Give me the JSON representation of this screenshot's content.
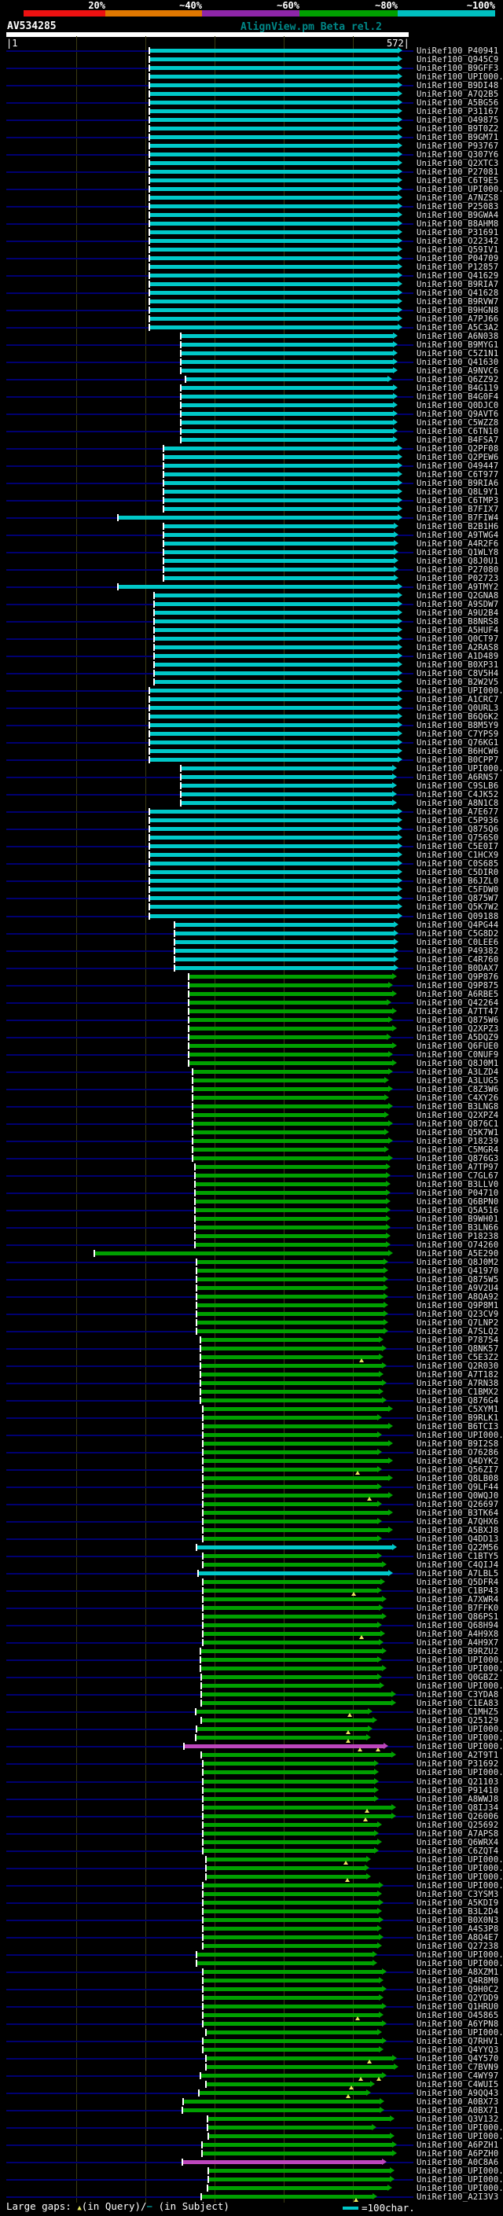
{
  "header": {
    "identity_key": {
      "labels": [
        "20%",
        "~40%",
        "~60%",
        "~80%",
        "~100%"
      ],
      "colors": [
        "#ee1111",
        "#e07800",
        "#8e26a8",
        "#00a000",
        "#00c0c0"
      ],
      "segment_bounds": [
        30,
        134,
        257,
        381,
        506,
        630
      ]
    },
    "query_name": "AV534285",
    "app_title": "AlignView.pm Beta rel.2",
    "ruler": {
      "start_label": "|1",
      "end_label": "572|",
      "start": 1,
      "end": 572,
      "ticks": [
        100,
        200,
        300,
        400,
        500
      ]
    }
  },
  "legend_footer": {
    "large_gaps_prefix": "Large gaps: ",
    "query_gap_symbol": "▲",
    "in_query": "(in Query)/",
    "subject_gap_symbol": "−",
    "in_subject": " (in Subject)",
    "scale_text": "=100char."
  },
  "colors": {
    "c": "#00c8c8",
    "g": "#00a000",
    "m": "#bc46bc",
    "leader": "#000070",
    "gap_marker": "#e8e860",
    "scale_swatch": "#00c8c8"
  },
  "label_prefix": "UniRef100_",
  "rows": [
    [
      "P40941",
      "c",
      190,
      512
    ],
    [
      "Q945C9",
      "c",
      190,
      512
    ],
    [
      "B9GFF3",
      "c",
      190,
      512
    ],
    [
      "UPI000..",
      "c",
      190,
      512
    ],
    [
      "B9DI48",
      "c",
      190,
      512
    ],
    [
      "A7Q2B5",
      "c",
      190,
      512
    ],
    [
      "A5BG56",
      "c",
      190,
      512
    ],
    [
      "P31167",
      "c",
      190,
      512
    ],
    [
      "O49875",
      "c",
      190,
      512
    ],
    [
      "B9T0Z2",
      "c",
      190,
      512
    ],
    [
      "B9GM71",
      "c",
      190,
      512
    ],
    [
      "P93767",
      "c",
      190,
      512
    ],
    [
      "Q307Y6",
      "c",
      190,
      512
    ],
    [
      "Q2XTC3",
      "c",
      190,
      512
    ],
    [
      "P27081",
      "c",
      190,
      512
    ],
    [
      "C6T9E5",
      "c",
      190,
      512
    ],
    [
      "UPI000..",
      "c",
      190,
      512
    ],
    [
      "A7NZS8",
      "c",
      190,
      512
    ],
    [
      "P25083",
      "c",
      190,
      512
    ],
    [
      "B9GWA4",
      "c",
      190,
      512
    ],
    [
      "B8AHM8",
      "c",
      190,
      512
    ],
    [
      "P31691",
      "c",
      190,
      512
    ],
    [
      "O22342",
      "c",
      190,
      512
    ],
    [
      "Q59IV1",
      "c",
      190,
      512
    ],
    [
      "P04709",
      "c",
      190,
      512
    ],
    [
      "P12857",
      "c",
      190,
      512
    ],
    [
      "Q41629",
      "c",
      190,
      512
    ],
    [
      "B9RIA7",
      "c",
      190,
      512
    ],
    [
      "Q41628",
      "c",
      190,
      512
    ],
    [
      "B9RVW7",
      "c",
      190,
      512
    ],
    [
      "B9HGN8",
      "c",
      190,
      512
    ],
    [
      "A7PJ66",
      "c",
      190,
      512
    ],
    [
      "A5C3A2",
      "c",
      190,
      512
    ],
    [
      "A6N038",
      "c",
      230,
      506
    ],
    [
      "B9MYG1",
      "c",
      230,
      506
    ],
    [
      "C5Z1N1",
      "c",
      230,
      506
    ],
    [
      "Q41630",
      "c",
      230,
      506
    ],
    [
      "A9NVC6",
      "c",
      230,
      506
    ],
    [
      "Q6ZZ92",
      "c",
      236,
      499
    ],
    [
      "B4G119",
      "c",
      230,
      506
    ],
    [
      "B4G0F4",
      "c",
      230,
      506
    ],
    [
      "Q0DJC0",
      "c",
      230,
      506
    ],
    [
      "Q9AVT6",
      "c",
      230,
      506
    ],
    [
      "C5WZZ8",
      "c",
      230,
      506
    ],
    [
      "C6TN10",
      "c",
      230,
      506
    ],
    [
      "B4FSA7",
      "c",
      230,
      506
    ],
    [
      "Q2PF08",
      "c",
      208,
      512
    ],
    [
      "Q2PEW6",
      "c",
      208,
      512
    ],
    [
      "O49447",
      "c",
      208,
      512
    ],
    [
      "C6T977",
      "c",
      208,
      512
    ],
    [
      "B9RIA6",
      "c",
      208,
      512
    ],
    [
      "Q8L9Y1",
      "c",
      208,
      512
    ],
    [
      "C6TMP3",
      "c",
      208,
      512
    ],
    [
      "B7FIX7",
      "c",
      208,
      512
    ],
    [
      "B7FIW4",
      "c",
      150,
      512
    ],
    [
      "B2B1H6",
      "c",
      208,
      507
    ],
    [
      "A9TWG4",
      "c",
      208,
      507
    ],
    [
      "A4R2F6",
      "c",
      208,
      507
    ],
    [
      "Q1WLY8",
      "c",
      208,
      507
    ],
    [
      "Q8J0U1",
      "c",
      208,
      507
    ],
    [
      "P27080",
      "c",
      208,
      507
    ],
    [
      "P02723",
      "c",
      208,
      507
    ],
    [
      "A9TMY2",
      "c",
      150,
      512
    ],
    [
      "Q2GNA8",
      "c",
      196,
      512
    ],
    [
      "A9SDW7",
      "c",
      196,
      512
    ],
    [
      "A9U2B4",
      "c",
      196,
      512
    ],
    [
      "B8NRS8",
      "c",
      196,
      512
    ],
    [
      "A5HUF4",
      "c",
      196,
      512
    ],
    [
      "Q0CT97",
      "c",
      196,
      512
    ],
    [
      "A2RAS8",
      "c",
      196,
      512
    ],
    [
      "A1D489",
      "c",
      196,
      512
    ],
    [
      "B0XP31",
      "c",
      196,
      512
    ],
    [
      "C8V5H4",
      "c",
      196,
      512
    ],
    [
      "B2W2V5",
      "c",
      196,
      512
    ],
    [
      "UPI000..",
      "c",
      190,
      512
    ],
    [
      "A1CRC7",
      "c",
      190,
      512
    ],
    [
      "Q0URL3",
      "c",
      190,
      512
    ],
    [
      "B6Q6K2",
      "c",
      190,
      512
    ],
    [
      "B8M5Y9",
      "c",
      190,
      512
    ],
    [
      "C7YPS9",
      "c",
      190,
      512
    ],
    [
      "Q76KG1",
      "c",
      190,
      512
    ],
    [
      "B6HCW6",
      "c",
      190,
      512
    ],
    [
      "B0CPP7",
      "c",
      190,
      512
    ],
    [
      "UPI000..",
      "c",
      230,
      505
    ],
    [
      "A6RNS7",
      "c",
      230,
      505
    ],
    [
      "C9SLB6",
      "c",
      230,
      505
    ],
    [
      "C4JK52",
      "c",
      230,
      505
    ],
    [
      "A8N1C8",
      "c",
      230,
      505
    ],
    [
      "A7E677",
      "c",
      190,
      512
    ],
    [
      "C5P936",
      "c",
      190,
      512
    ],
    [
      "Q875Q6",
      "c",
      190,
      512
    ],
    [
      "Q756S0",
      "c",
      190,
      512
    ],
    [
      "C5E0I7",
      "c",
      190,
      512
    ],
    [
      "C1HCX9",
      "c",
      190,
      512
    ],
    [
      "C0S685",
      "c",
      190,
      512
    ],
    [
      "C5DIR0",
      "c",
      190,
      512
    ],
    [
      "B6JZL0",
      "c",
      190,
      512
    ],
    [
      "C5FDW0",
      "c",
      190,
      512
    ],
    [
      "Q875W7",
      "c",
      190,
      512
    ],
    [
      "Q5K7W2",
      "c",
      190,
      512
    ],
    [
      "Q09188",
      "c",
      190,
      512
    ],
    [
      "Q4PG44",
      "c",
      222,
      507
    ],
    [
      "C5G8D2",
      "c",
      222,
      507
    ],
    [
      "C0LEE6",
      "c",
      222,
      507
    ],
    [
      "P49382",
      "c",
      222,
      507
    ],
    [
      "C4R760",
      "c",
      222,
      507
    ],
    [
      "B0DAX7",
      "c",
      222,
      507
    ],
    [
      "Q9P876",
      "g",
      240,
      505
    ],
    [
      "Q9P875",
      "g",
      240,
      500
    ],
    [
      "A6RBE5",
      "g",
      240,
      505
    ],
    [
      "Q42264",
      "g",
      240,
      498
    ],
    [
      "A7TT47",
      "g",
      240,
      505
    ],
    [
      "Q875W6",
      "g",
      240,
      500
    ],
    [
      "Q2XPZ3",
      "g",
      240,
      505
    ],
    [
      "A5DQZ9",
      "g",
      240,
      498
    ],
    [
      "Q6FUE0",
      "g",
      240,
      505
    ],
    [
      "C0NUF9",
      "g",
      240,
      500
    ],
    [
      "Q8J0M1",
      "g",
      240,
      505
    ],
    [
      "A3LZD4",
      "g",
      245,
      500
    ],
    [
      "A3LUG5",
      "g",
      245,
      495
    ],
    [
      "C8Z3W6",
      "g",
      245,
      500
    ],
    [
      "C4XY26",
      "g",
      245,
      495
    ],
    [
      "B3LNG8",
      "g",
      245,
      500
    ],
    [
      "Q2XPZ4",
      "g",
      245,
      495
    ],
    [
      "Q876C1",
      "g",
      245,
      500
    ],
    [
      "Q5K7W1",
      "g",
      245,
      495
    ],
    [
      "P18239",
      "g",
      245,
      500
    ],
    [
      "C5MGR4",
      "g",
      245,
      495
    ],
    [
      "Q876G3",
      "g",
      245,
      500
    ],
    [
      "A7TP97",
      "g",
      248,
      497
    ],
    [
      "C7GL67",
      "g",
      248,
      497
    ],
    [
      "B3LLV0",
      "g",
      248,
      497
    ],
    [
      "P04710",
      "g",
      248,
      497
    ],
    [
      "Q6BPN0",
      "g",
      248,
      497
    ],
    [
      "Q5A516",
      "g",
      248,
      497
    ],
    [
      "B9WH01",
      "g",
      248,
      497
    ],
    [
      "B3LN66",
      "g",
      248,
      497
    ],
    [
      "P18238",
      "g",
      248,
      497
    ],
    [
      "O74260",
      "g",
      248,
      497
    ],
    [
      "A5E290",
      "g",
      120,
      500
    ],
    [
      "Q8J0M2",
      "g",
      250,
      494
    ],
    [
      "Q41970",
      "g",
      250,
      494
    ],
    [
      "Q875W5",
      "g",
      250,
      494
    ],
    [
      "A9V2U4",
      "g",
      250,
      494
    ],
    [
      "A8QA92",
      "g",
      250,
      494
    ],
    [
      "Q9P8M1",
      "g",
      250,
      494
    ],
    [
      "Q23CV9",
      "g",
      250,
      494
    ],
    [
      "Q7LNP2",
      "g",
      250,
      494
    ],
    [
      "A7SLQ2",
      "g",
      250,
      494
    ],
    [
      "P78754",
      "g",
      255,
      488
    ],
    [
      "Q8NK57",
      "g",
      255,
      492
    ],
    [
      "C5E3Z2",
      "g",
      255,
      488,
      [
        460
      ]
    ],
    [
      "Q2R030",
      "g",
      255,
      492
    ],
    [
      "A7T182",
      "g",
      255,
      488
    ],
    [
      "A7RN38",
      "g",
      255,
      492
    ],
    [
      "C1BMX2",
      "g",
      255,
      488
    ],
    [
      "Q876G4",
      "g",
      255,
      492
    ],
    [
      "C5XYM1",
      "g",
      258,
      500
    ],
    [
      "B9RLK1",
      "g",
      258,
      486
    ],
    [
      "B6TCI3",
      "g",
      258,
      500
    ],
    [
      "UPI000..",
      "g",
      258,
      486
    ],
    [
      "B9I2S8",
      "g",
      258,
      500
    ],
    [
      "O76286",
      "g",
      258,
      486
    ],
    [
      "Q4DYK2",
      "g",
      258,
      500
    ],
    [
      "Q56ZI7",
      "g",
      258,
      486,
      [
        455
      ]
    ],
    [
      "Q8LB08",
      "g",
      258,
      500
    ],
    [
      "Q9LF44",
      "g",
      258,
      486
    ],
    [
      "Q0WQJ0",
      "g",
      258,
      500,
      [
        470
      ]
    ],
    [
      "Q26697",
      "g",
      258,
      486
    ],
    [
      "B3TK64",
      "g",
      258,
      500
    ],
    [
      "A7QHX6",
      "g",
      258,
      486
    ],
    [
      "A5BXJ8",
      "g",
      258,
      500
    ],
    [
      "Q4DD13",
      "g",
      258,
      486
    ],
    [
      "Q22M56",
      "c",
      250,
      505
    ],
    [
      "C1BTY5",
      "g",
      258,
      486
    ],
    [
      "C4QIJ4",
      "g",
      258,
      492
    ],
    [
      "A7LBL5",
      "c",
      252,
      500
    ],
    [
      "Q5DFR4",
      "g",
      258,
      490
    ],
    [
      "C1BP43",
      "g",
      258,
      486,
      [
        450
      ]
    ],
    [
      "A7XWR4",
      "g",
      258,
      492
    ],
    [
      "B7FFK0",
      "g",
      258,
      488
    ],
    [
      "Q86PS1",
      "g",
      258,
      492
    ],
    [
      "Q68H94",
      "g",
      258,
      486
    ],
    [
      "A4H9X8",
      "g",
      258,
      490,
      [
        460
      ]
    ],
    [
      "A4H9X7",
      "g",
      258,
      488
    ],
    [
      "B9RZU2",
      "g",
      255,
      492
    ],
    [
      "UPI000..",
      "g",
      255,
      486
    ],
    [
      "UPI000..",
      "g",
      255,
      492
    ],
    [
      "Q0GBZ2",
      "g",
      256,
      486
    ],
    [
      "UPI000..",
      "g",
      256,
      489
    ],
    [
      "C3YDA8",
      "g",
      256,
      504
    ],
    [
      "C1EA83",
      "g",
      256,
      504
    ],
    [
      "C1MHZ5",
      "g",
      249,
      474,
      [
        445
      ]
    ],
    [
      "Q25129",
      "g",
      256,
      480
    ],
    [
      "UPI000..",
      "g",
      250,
      474,
      [
        443
      ]
    ],
    [
      "UPI000..",
      "g",
      249,
      472,
      [
        443
      ]
    ],
    [
      "UPI000..",
      "m",
      234,
      494,
      [
        458,
        481
      ]
    ],
    [
      "A2T9T1",
      "g",
      256,
      504
    ],
    [
      "P31692",
      "g",
      258,
      482
    ],
    [
      "UPI000..",
      "g",
      258,
      482
    ],
    [
      "Q21103",
      "g",
      258,
      482
    ],
    [
      "P91410",
      "g",
      258,
      482
    ],
    [
      "A8WWJ8",
      "g",
      258,
      482
    ],
    [
      "Q8IJ34",
      "g",
      258,
      504,
      [
        467
      ]
    ],
    [
      "Q26006",
      "g",
      258,
      504,
      [
        465
      ]
    ],
    [
      "Q25692",
      "g",
      258,
      486
    ],
    [
      "A7APS8",
      "g",
      258,
      482
    ],
    [
      "Q6WRX4",
      "g",
      258,
      486
    ],
    [
      "C6ZQT4",
      "g",
      258,
      482
    ],
    [
      "UPI000..",
      "g",
      262,
      472,
      [
        440
      ]
    ],
    [
      "UPI000..",
      "g",
      262,
      470
    ],
    [
      "UPI000..",
      "g",
      262,
      472,
      [
        442
      ]
    ],
    [
      "UPI000..",
      "g",
      258,
      488
    ],
    [
      "C3YSM3",
      "g",
      258,
      486
    ],
    [
      "A5KDI9",
      "g",
      258,
      488
    ],
    [
      "B3L2D4",
      "g",
      258,
      486
    ],
    [
      "B0X0N3",
      "g",
      258,
      488
    ],
    [
      "A4S3P8",
      "g",
      258,
      486
    ],
    [
      "A8Q4E7",
      "g",
      258,
      488
    ],
    [
      "Q27238",
      "g",
      258,
      486
    ],
    [
      "UPI000..",
      "g",
      250,
      480
    ],
    [
      "UPI000..",
      "g",
      250,
      480
    ],
    [
      "A8XZM1",
      "g",
      258,
      492
    ],
    [
      "Q4R8M0",
      "g",
      258,
      488
    ],
    [
      "Q9H0C2",
      "g",
      258,
      492
    ],
    [
      "Q2YDD9",
      "g",
      258,
      488
    ],
    [
      "Q1HRU0",
      "g",
      258,
      492
    ],
    [
      "O45865",
      "g",
      258,
      488,
      [
        455
      ]
    ],
    [
      "A6YPN8",
      "g",
      258,
      492
    ],
    [
      "UPI000..",
      "g",
      262,
      486
    ],
    [
      "Q7RHV1",
      "g",
      258,
      492
    ],
    [
      "Q4YYQ3",
      "g",
      258,
      488
    ],
    [
      "Q4Y570",
      "g",
      262,
      505,
      [
        470
      ]
    ],
    [
      "C7BVN9",
      "g",
      262,
      507
    ],
    [
      "C4WY97",
      "g",
      255,
      492,
      [
        459,
        482
      ]
    ],
    [
      "C4WUI5",
      "g",
      262,
      477,
      [
        447
      ]
    ],
    [
      "A9QQ43",
      "g",
      253,
      472,
      [
        443
      ]
    ],
    [
      "A0BX73",
      "g",
      233,
      489
    ],
    [
      "A0BX71",
      "g",
      232,
      489
    ],
    [
      "Q3V132",
      "g",
      264,
      502
    ],
    [
      "UPI000..",
      "g",
      264,
      479
    ],
    [
      "UPI000..",
      "g",
      265,
      502
    ],
    [
      "A6PZH1",
      "g",
      257,
      505
    ],
    [
      "A6PZH0",
      "g",
      257,
      505
    ],
    [
      "A0C8A6",
      "m",
      232,
      492
    ],
    [
      "UPI000..",
      "g",
      265,
      502
    ],
    [
      "UPI000..",
      "g",
      265,
      502
    ],
    [
      "UPI000..",
      "g",
      264,
      499
    ],
    [
      "A2I3V3",
      "g",
      256,
      480,
      [
        453
      ]
    ]
  ]
}
